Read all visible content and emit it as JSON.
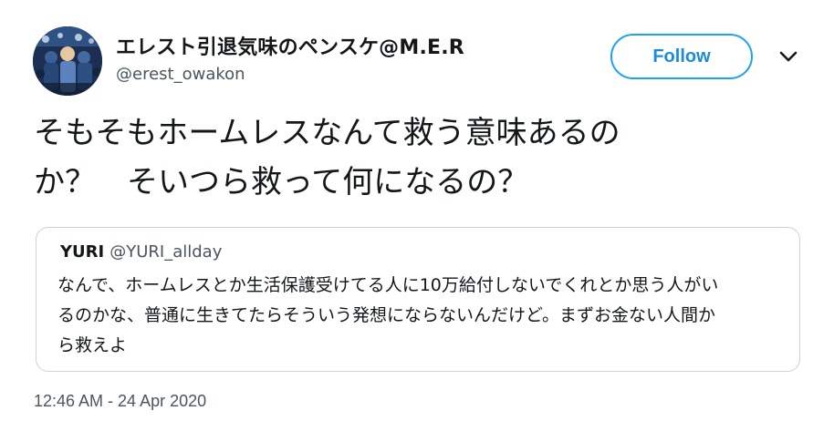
{
  "author": {
    "display_name": "エレスト引退気味のペンスケ@M.E.R",
    "handle": "@erest_owakon",
    "avatar": "crowd-photo-avatar"
  },
  "follow_button": {
    "label": "Follow"
  },
  "menu_icon": "chevron-down-icon",
  "tweet": {
    "text_line1": "そもそもホームレスなんて救う意味あるの",
    "text_line2": "か？　そいつら救って何になるの？",
    "timestamp": "12:46 AM - 24 Apr 2020"
  },
  "quoted_tweet": {
    "name": "YURI",
    "handle": "@YURI_allday",
    "text_line1": "なんで、ホームレスとか生活保護受けてる人に10万給付しないでくれとか思う人がい",
    "text_line2": "るのかな、普通に生きてたらそういう発想にならないんだけど。まずお金ない人間か",
    "text_line3": "ら救えよ"
  },
  "colors": {
    "accent": "#1da1f2",
    "text_primary": "#14171a",
    "text_secondary": "#4a5560",
    "border": "#c9d3dc"
  }
}
